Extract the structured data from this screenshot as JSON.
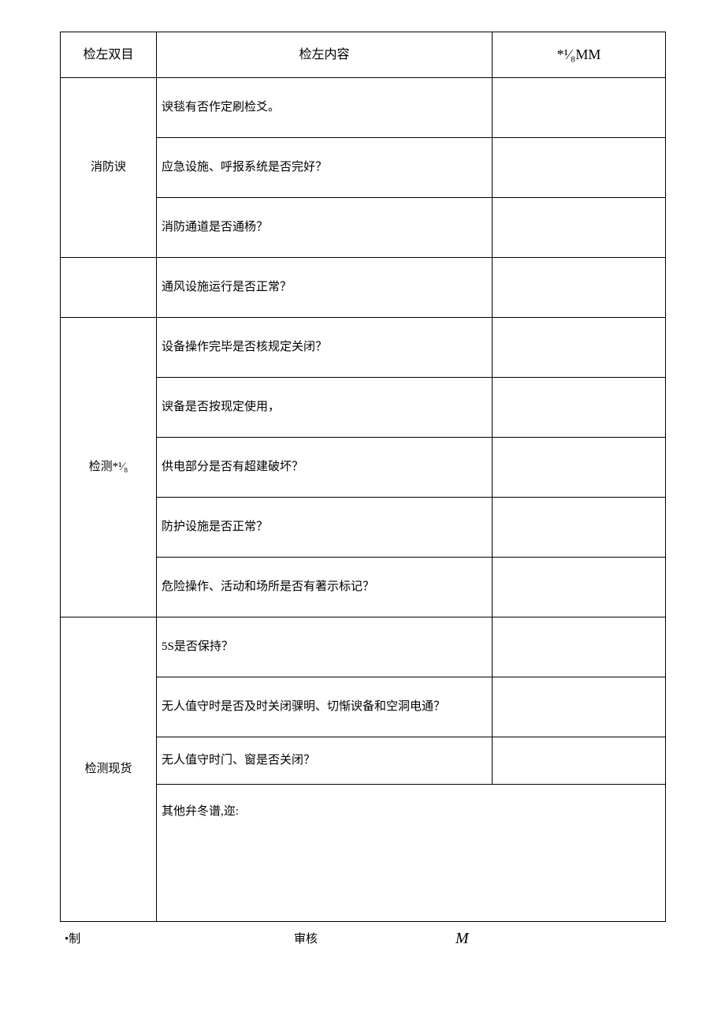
{
  "header": {
    "col1": "检左双目",
    "col2": "检左内容",
    "col3": "*¹⁄₈MM"
  },
  "categories": {
    "fire": "消防谀",
    "detection": "检测*¹⁄₈",
    "site": "检测现货"
  },
  "rows": {
    "r1": "谀毯有否作定刷检爻。",
    "r2": "应急设施、呼报系统是否完好？",
    "r3": "消防通道是否通杨？",
    "r4": "通风设施运行是否正常？",
    "r5": "设备操作完毕是否核规定关闭？",
    "r6": "谀备是否按现定使用，",
    "r7": "供电部分是否有超建破坏？",
    "r8": "防护设施是否正常？",
    "r9": "危险操作、活动和场所是否有著示标记？",
    "r10": "5S是否保持？",
    "r11": "无人值守时是否及时关闭骒明、切惭谀备和空洞电通？",
    "r12": "无人值守时门、窗是否关闭？",
    "desc": "其他弁冬谱,迩:"
  },
  "footer": {
    "f1": "•制",
    "f2": "审核",
    "f3": "M"
  }
}
